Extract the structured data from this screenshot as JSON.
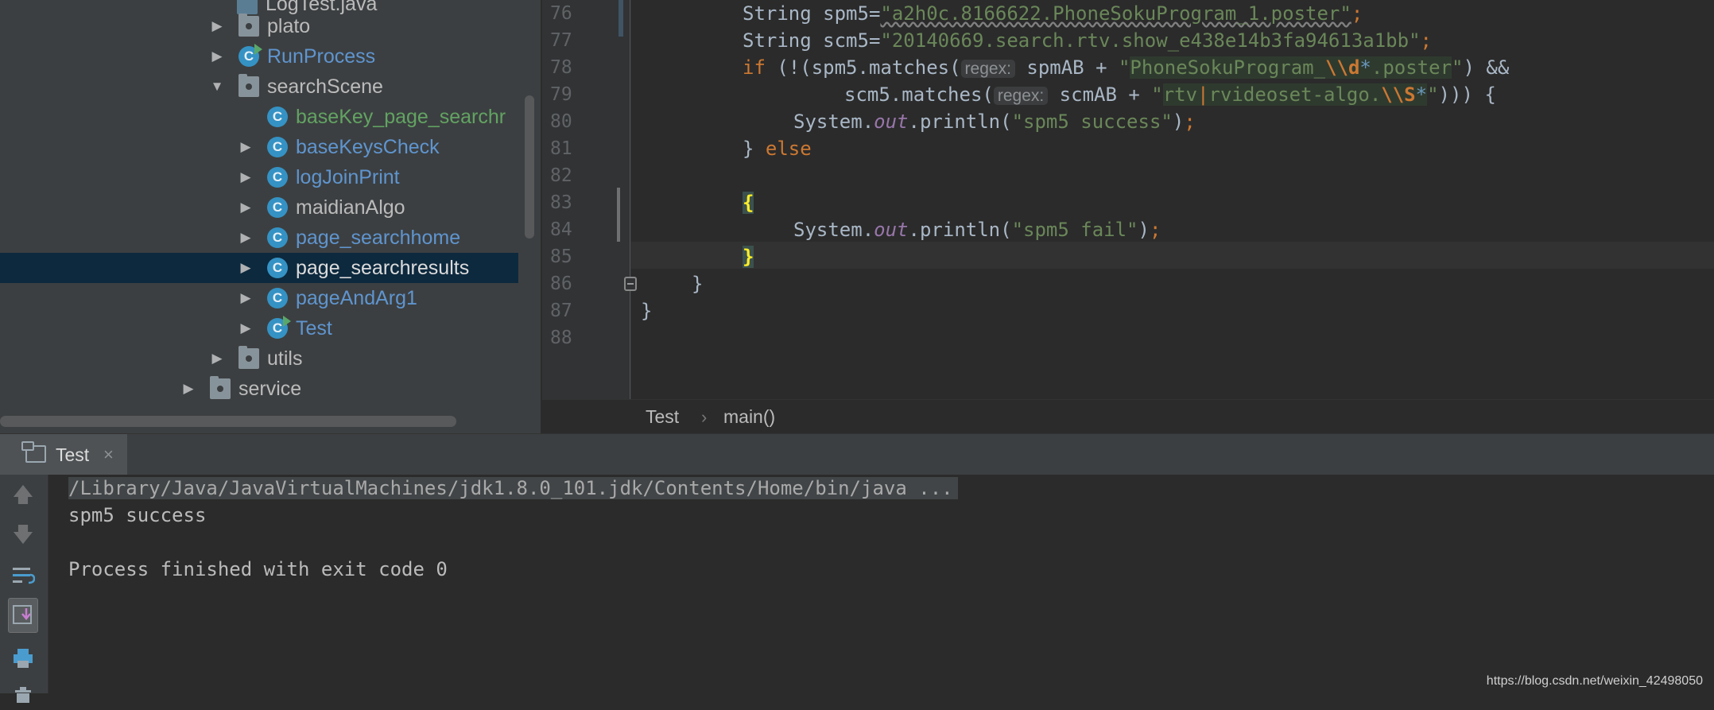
{
  "project_tree": {
    "items": [
      {
        "label": "LogTest.java",
        "kind": "file",
        "expanded": false
      },
      {
        "label": "plato",
        "kind": "package",
        "expanded": false
      },
      {
        "label": "RunProcess",
        "kind": "class",
        "expanded": false
      },
      {
        "label": "searchScene",
        "kind": "package",
        "expanded": true
      },
      {
        "label": "baseKey_page_searchr",
        "kind": "class"
      },
      {
        "label": "baseKeysCheck",
        "kind": "class",
        "expanded": false
      },
      {
        "label": "logJoinPrint",
        "kind": "class",
        "expanded": false
      },
      {
        "label": "maidianAlgo",
        "kind": "class",
        "expanded": false
      },
      {
        "label": "page_searchhome",
        "kind": "class",
        "expanded": false
      },
      {
        "label": "page_searchresults",
        "kind": "class",
        "expanded": false,
        "selected": true
      },
      {
        "label": "pageAndArg1",
        "kind": "class",
        "expanded": false
      },
      {
        "label": "Test",
        "kind": "class",
        "expanded": false
      },
      {
        "label": "utils",
        "kind": "package",
        "expanded": false
      },
      {
        "label": "service",
        "kind": "package",
        "expanded": false
      }
    ]
  },
  "editor": {
    "line_numbers": [
      "76",
      "77",
      "78",
      "79",
      "80",
      "81",
      "82",
      "83",
      "84",
      "85",
      "86",
      "87",
      "88"
    ],
    "code": {
      "l76": {
        "type": "String ",
        "var": "spm5=",
        "value": "\"a2h0c.8166622.PhoneSokuProgram_1.poster\"",
        "semi": ";"
      },
      "l77": {
        "type": "String ",
        "var": "scm5=",
        "value": "\"20140669.search.rtv.show_e438e14b3fa94613a1bb\"",
        "semi": ";"
      },
      "l78": {
        "kw": "if",
        "pre": " (!(spm5.matches(",
        "hint": "regex:",
        "mid": " spmAB + ",
        "q1": "\"",
        "rx1": "PhoneSokuProgram_",
        "esc1": "\\\\d",
        "meta1": "*",
        "rx2": ".poster",
        "q2": "\"",
        "post": ") &&"
      },
      "l79": {
        "pre": "scm5.matches(",
        "hint": "regex:",
        "mid": " scmAB + ",
        "q1": "\"",
        "rx1": "rtv",
        "pipe": "|",
        "rx2": "rvideoset-algo.",
        "esc1": "\\\\S",
        "meta1": "*",
        "q2": "\"",
        "post": "))) {"
      },
      "l80": {
        "obj": "System.",
        "field": "out",
        "call": ".println(",
        "value": "\"spm5 success\"",
        "close": ")",
        "semi": ";"
      },
      "l81": {
        "brace": "} ",
        "kw": "else"
      },
      "l83": {
        "brace": "{"
      },
      "l84": {
        "obj": "System.",
        "field": "out",
        "call": ".println(",
        "value": "\"spm5 fail\"",
        "close": ")",
        "semi": ";"
      },
      "l85": {
        "brace": "}"
      },
      "l86": {
        "brace": "}"
      },
      "l87": {
        "brace": "}"
      }
    }
  },
  "breadcrumb": {
    "items": [
      "Test",
      "main()"
    ],
    "separator": "›"
  },
  "run_panel": {
    "tab_label": "Test",
    "close_glyph": "×",
    "console_lines": [
      "/Library/Java/JavaVirtualMachines/jdk1.8.0_101.jdk/Contents/Home/bin/java ...",
      "spm5 success",
      "",
      "Process finished with exit code 0"
    ],
    "toolbar_icons": [
      "arrow-up-icon",
      "arrow-down-icon",
      "soft-wrap-icon",
      "scroll-to-end-icon",
      "print-icon",
      "trash-icon"
    ]
  },
  "watermark": "https://blog.csdn.net/weixin_42498050",
  "colors": {
    "background": "#2b2b2b",
    "tree_background": "#3c3f41",
    "selection": "#0d293e",
    "keyword": "#cc7832",
    "string": "#6a8759",
    "line_number": "#606366"
  }
}
